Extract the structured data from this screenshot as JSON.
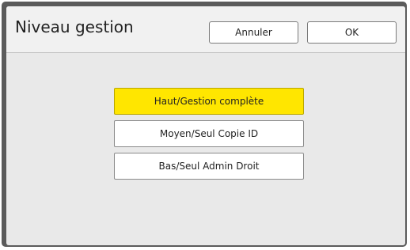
{
  "dialog": {
    "title": "Niveau gestion",
    "cancel_label": "Annuler",
    "ok_label": "OK"
  },
  "options": [
    {
      "label": "Haut/Gestion complète",
      "selected": true
    },
    {
      "label": "Moyen/Seul Copie ID",
      "selected": false
    },
    {
      "label": "Bas/Seul Admin Droit",
      "selected": false
    }
  ],
  "colors": {
    "selected_background": "#ffe600",
    "frame": "#5b5b5b",
    "panel_background": "#e9e9e9"
  }
}
